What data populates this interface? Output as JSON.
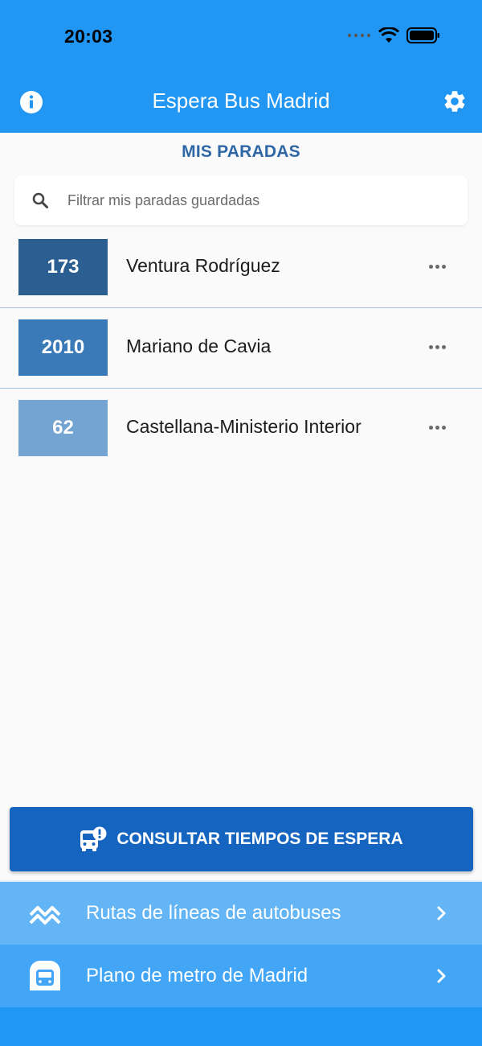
{
  "status_bar": {
    "time": "20:03"
  },
  "app_bar": {
    "title": "Espera Bus Madrid",
    "info_icon": "info-icon",
    "settings_icon": "gear-icon",
    "color": "#2196f3"
  },
  "section": {
    "title": "MIS PARADAS"
  },
  "search": {
    "placeholder": "Filtrar mis paradas guardadas",
    "value": ""
  },
  "stops": [
    {
      "number": "173",
      "name": "Ventura Rodríguez",
      "color": "#2b5f91"
    },
    {
      "number": "2010",
      "name": "Mariano de Cavia",
      "color": "#3b7ab8"
    },
    {
      "number": "62",
      "name": "Castellana-Ministerio Interior",
      "color": "#74a4d1"
    }
  ],
  "main_button": {
    "label": "CONSULTAR TIEMPOS DE ESPERA",
    "icon": "bus-alert-icon",
    "color": "#1565c0"
  },
  "nav": {
    "routes_label": "Rutas de líneas de autobuses",
    "routes_icon": "route-icon",
    "metro_label": "Plano de metro de Madrid",
    "metro_icon": "metro-icon"
  }
}
